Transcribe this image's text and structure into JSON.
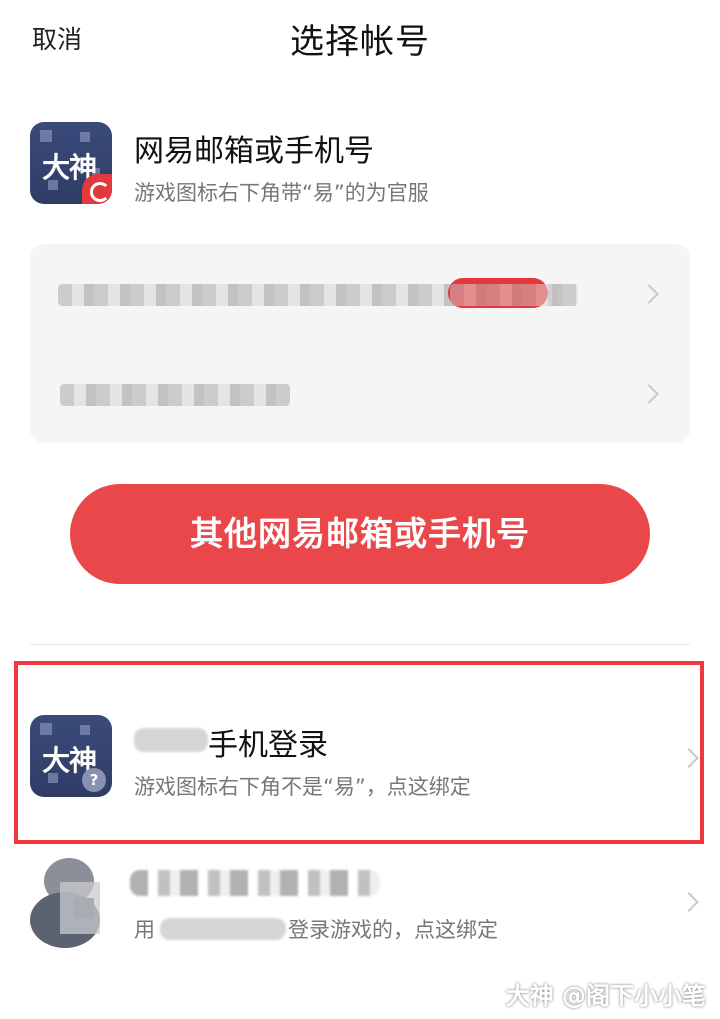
{
  "header": {
    "cancel_label": "取消",
    "title": "选择帐号"
  },
  "netease_section": {
    "title": "网易邮箱或手机号",
    "subtitle": "游戏图标右下角带“易”的为官服",
    "icon_text": "大神"
  },
  "accounts": [
    {
      "label": "yj...1270047404@163...",
      "blurred": true,
      "has_badge": true
    },
    {
      "label": "1884991749...",
      "blurred": true,
      "has_badge": false
    }
  ],
  "other_button_label": "其他网易邮箱或手机号",
  "phone_login": {
    "title": "手机登录",
    "subtitle": "游戏图标右下角不是“易”，点这绑定",
    "icon_text": "大神",
    "badge_glyph": "?"
  },
  "qq_login": {
    "subtitle_prefix": "用",
    "subtitle_suffix": "登录游戏的，点这绑定"
  },
  "watermark": "大神 @阁下小小笔",
  "colors": {
    "accent": "#e9474a",
    "highlight_border": "#f0383e",
    "card_bg": "#f5f5f5"
  }
}
